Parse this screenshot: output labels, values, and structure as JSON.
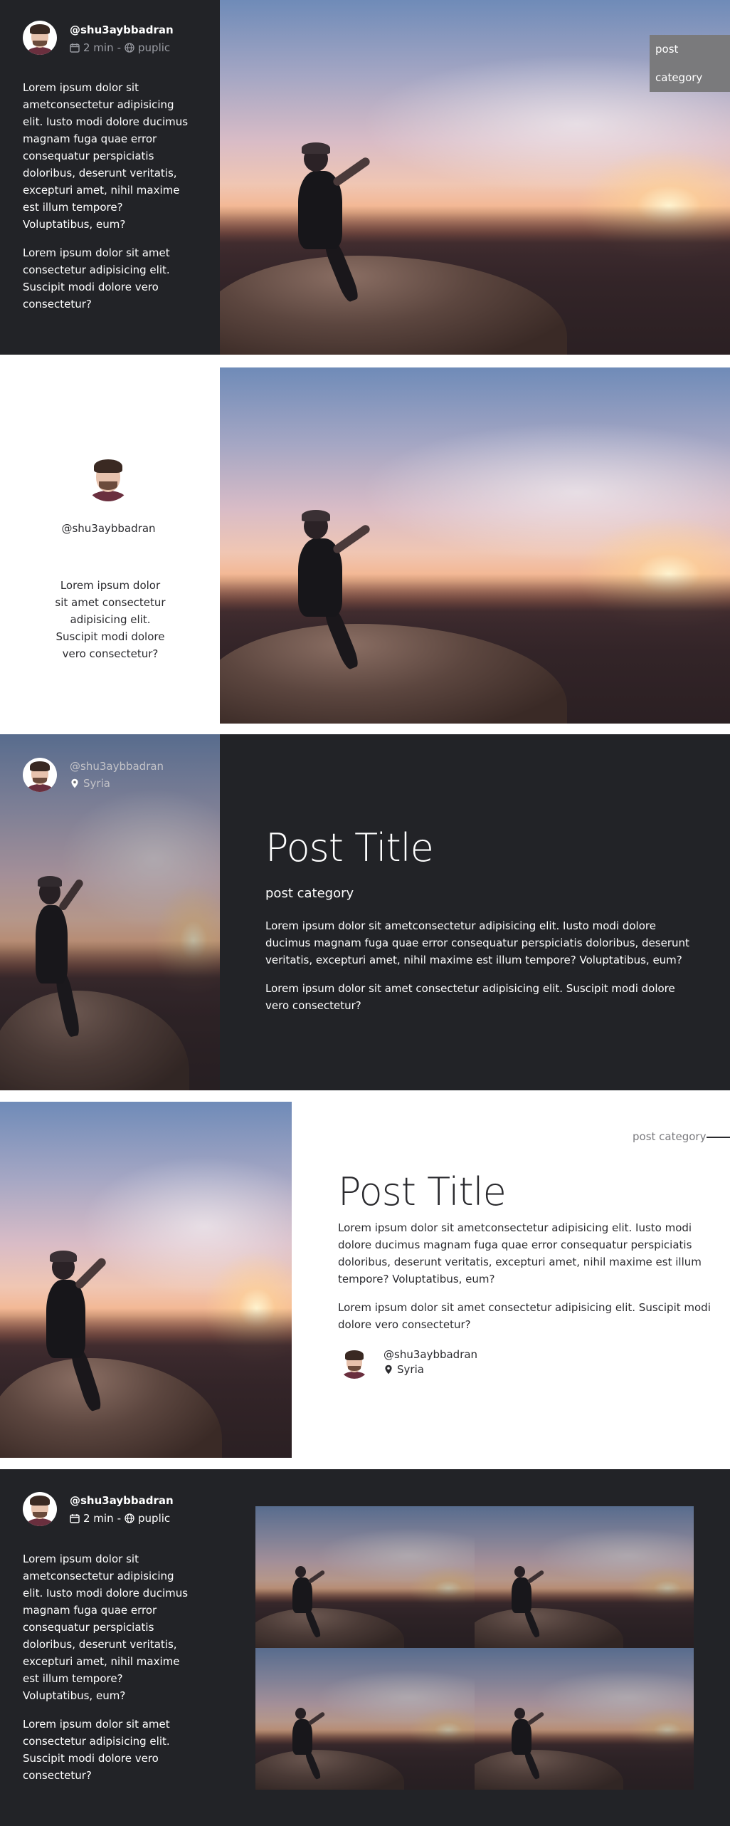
{
  "card1": {
    "username": "@shu3aybbadran",
    "read_time": "2 min",
    "separator": "-",
    "visibility": "puplic",
    "paragraph1": "Lorem ipsum dolor sit ametconsectetur adipisicing elit. Iusto modi dolore ducimus magnam fuga quae error consequatur perspiciatis doloribus, deserunt veritatis, excepturi amet, nihil maxime est illum tempore? Voluptatibus, eum?",
    "paragraph2": "Lorem ipsum dolor sit amet consectetur adipisicing elit. Suscipit modi dolore vero consectetur?",
    "category": "post category"
  },
  "card2": {
    "username": "@shu3aybbadran",
    "paragraph": "Lorem ipsum dolor sit amet consectetur adipisicing elit. Suscipit modi dolore vero consectetur?"
  },
  "card3": {
    "username": "@shu3aybbadran",
    "location": "Syria",
    "title": "Post Title",
    "category": "post category",
    "paragraph1": "Lorem ipsum dolor sit ametconsectetur adipisicing elit. Iusto modi dolore ducimus magnam fuga quae error consequatur perspiciatis doloribus, deserunt veritatis, excepturi amet, nihil maxime est illum tempore? Voluptatibus, eum?",
    "paragraph2": "Lorem ipsum dolor sit amet consectetur adipisicing elit. Suscipit modi dolore vero consectetur?"
  },
  "card4": {
    "category": "post category",
    "title": "Post Title",
    "paragraph1": "Lorem ipsum dolor sit ametconsectetur adipisicing elit. Iusto modi dolore ducimus magnam fuga quae error consequatur perspiciatis doloribus, deserunt veritatis, excepturi amet, nihil maxime est illum tempore? Voluptatibus, eum?",
    "paragraph2": "Lorem ipsum dolor sit amet consectetur adipisicing elit. Suscipit modi dolore vero consectetur?",
    "username": "@shu3aybbadran",
    "location": "Syria"
  },
  "card5": {
    "username": "@shu3aybbadran",
    "read_time": "2 min",
    "separator": "-",
    "visibility": "puplic",
    "paragraph1": "Lorem ipsum dolor sit ametconsectetur adipisicing elit. Iusto modi dolore ducimus magnam fuga quae error consequatur perspiciatis doloribus, deserunt veritatis, excepturi amet, nihil maxime est illum tempore? Voluptatibus, eum?",
    "paragraph2": "Lorem ipsum dolor sit amet consectetur adipisicing elit. Suscipit modi dolore vero consectetur?"
  },
  "icons": {
    "calendar": "calendar-icon",
    "globe": "globe-icon",
    "location": "map-marker-icon"
  },
  "colors": {
    "dark_bg": "#222327",
    "badge_bg": "#7a7a7c",
    "muted_text": "#9a9ca3"
  }
}
